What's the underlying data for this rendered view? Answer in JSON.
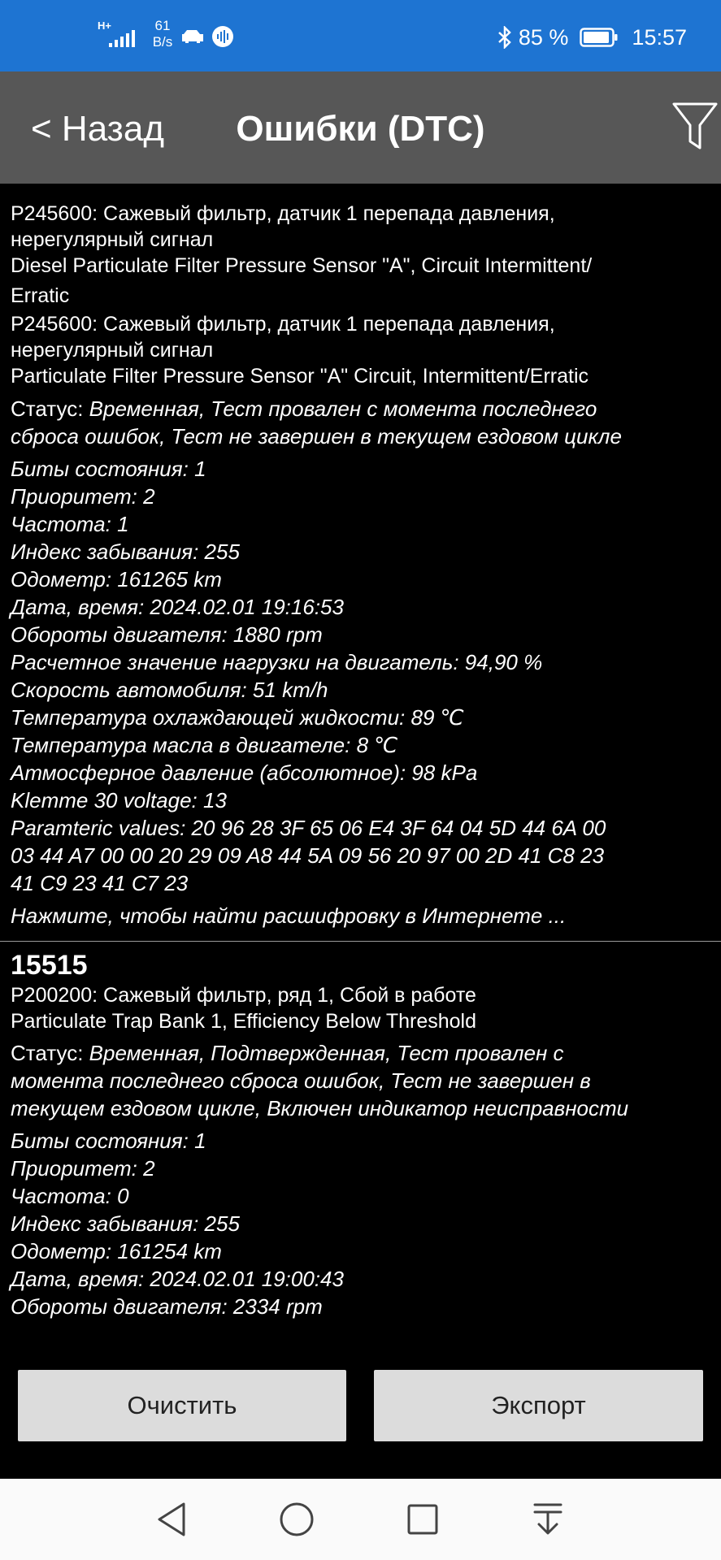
{
  "status_bar": {
    "net_type": "H+",
    "speed_value": "61",
    "speed_unit": "B/s",
    "battery_text": "85 %",
    "time": "15:57"
  },
  "toolbar": {
    "back_label": "< Назад",
    "title": "Ошибки (DTC)"
  },
  "entry1": {
    "lines": [
      "P245600: Сажевый фильтр, датчик 1 перепада давления,",
      "нерегулярный сигнал",
      "Diesel Particulate Filter Pressure Sensor \"A\", Circuit Intermittent/",
      "Erratic",
      "P245600: Сажевый фильтр, датчик 1 перепада давления,",
      "нерегулярный сигнал",
      "Particulate Filter Pressure Sensor \"A\" Circuit, Intermittent/Erratic"
    ],
    "status_label": "Статус: ",
    "status_line1": "Временная, Тест провален с момента последнего",
    "status_line2": "сброса ошибок, Тест не завершен в текущем ездовом цикле",
    "details": [
      "Биты состояния: 1",
      "Приоритет: 2",
      "Частота: 1",
      "Индекс забывания: 255",
      "Одометр: 161265 km",
      "Дата, время: 2024.02.01 19:16:53",
      "Обороты двигателя: 1880 rpm",
      "Расчетное значение нагрузки на двигатель: 94,90 %",
      "Скорость автомобиля: 51 km/h",
      "Температура охлаждающей жидкости: 89 ℃",
      "Температура масла в двигателе: 8 ℃",
      "Атмосферное давление (абсолютное): 98 kPa",
      "Klemme 30 voltage: 13",
      "Paramteric values:  20 96 28 3F 65 06 E4 3F 64 04 5D 44 6A 00",
      "03 44 A7 00 00 20 29 09 A8 44 5A 09 56 20 97 00 2D 41 C8 23",
      "41 C9 23 41 C7 23"
    ],
    "search_link": "Нажмите, чтобы найти расшифровку в Интернете ..."
  },
  "entry2": {
    "code": "15515",
    "lines": [
      "P200200: Сажевый фильтр, ряд 1, Сбой в работе",
      "Particulate Trap Bank 1, Efficiency Below Threshold"
    ],
    "status_label": "Статус: ",
    "status_line1": "Временная, Подтвержденная, Тест провален с",
    "status_line2": "момента последнего сброса ошибок, Тест не завершен в",
    "status_line3": "текущем ездовом цикле, Включен индикатор неисправности",
    "details": [
      "Биты состояния: 1",
      "Приоритет: 2",
      "Частота: 0",
      "Индекс забывания: 255",
      "Одометр: 161254 km",
      "Дата, время: 2024.02.01 19:00:43",
      "Обороты двигателя: 2334 rpm"
    ]
  },
  "buttons": {
    "clear_label": "Очистить",
    "export_label": "Экспорт"
  },
  "colors": {
    "status_bar": "#1e74d2",
    "toolbar": "#575757",
    "background": "#000000",
    "button": "#dcdcdc",
    "nav_bar": "#fafafa"
  }
}
